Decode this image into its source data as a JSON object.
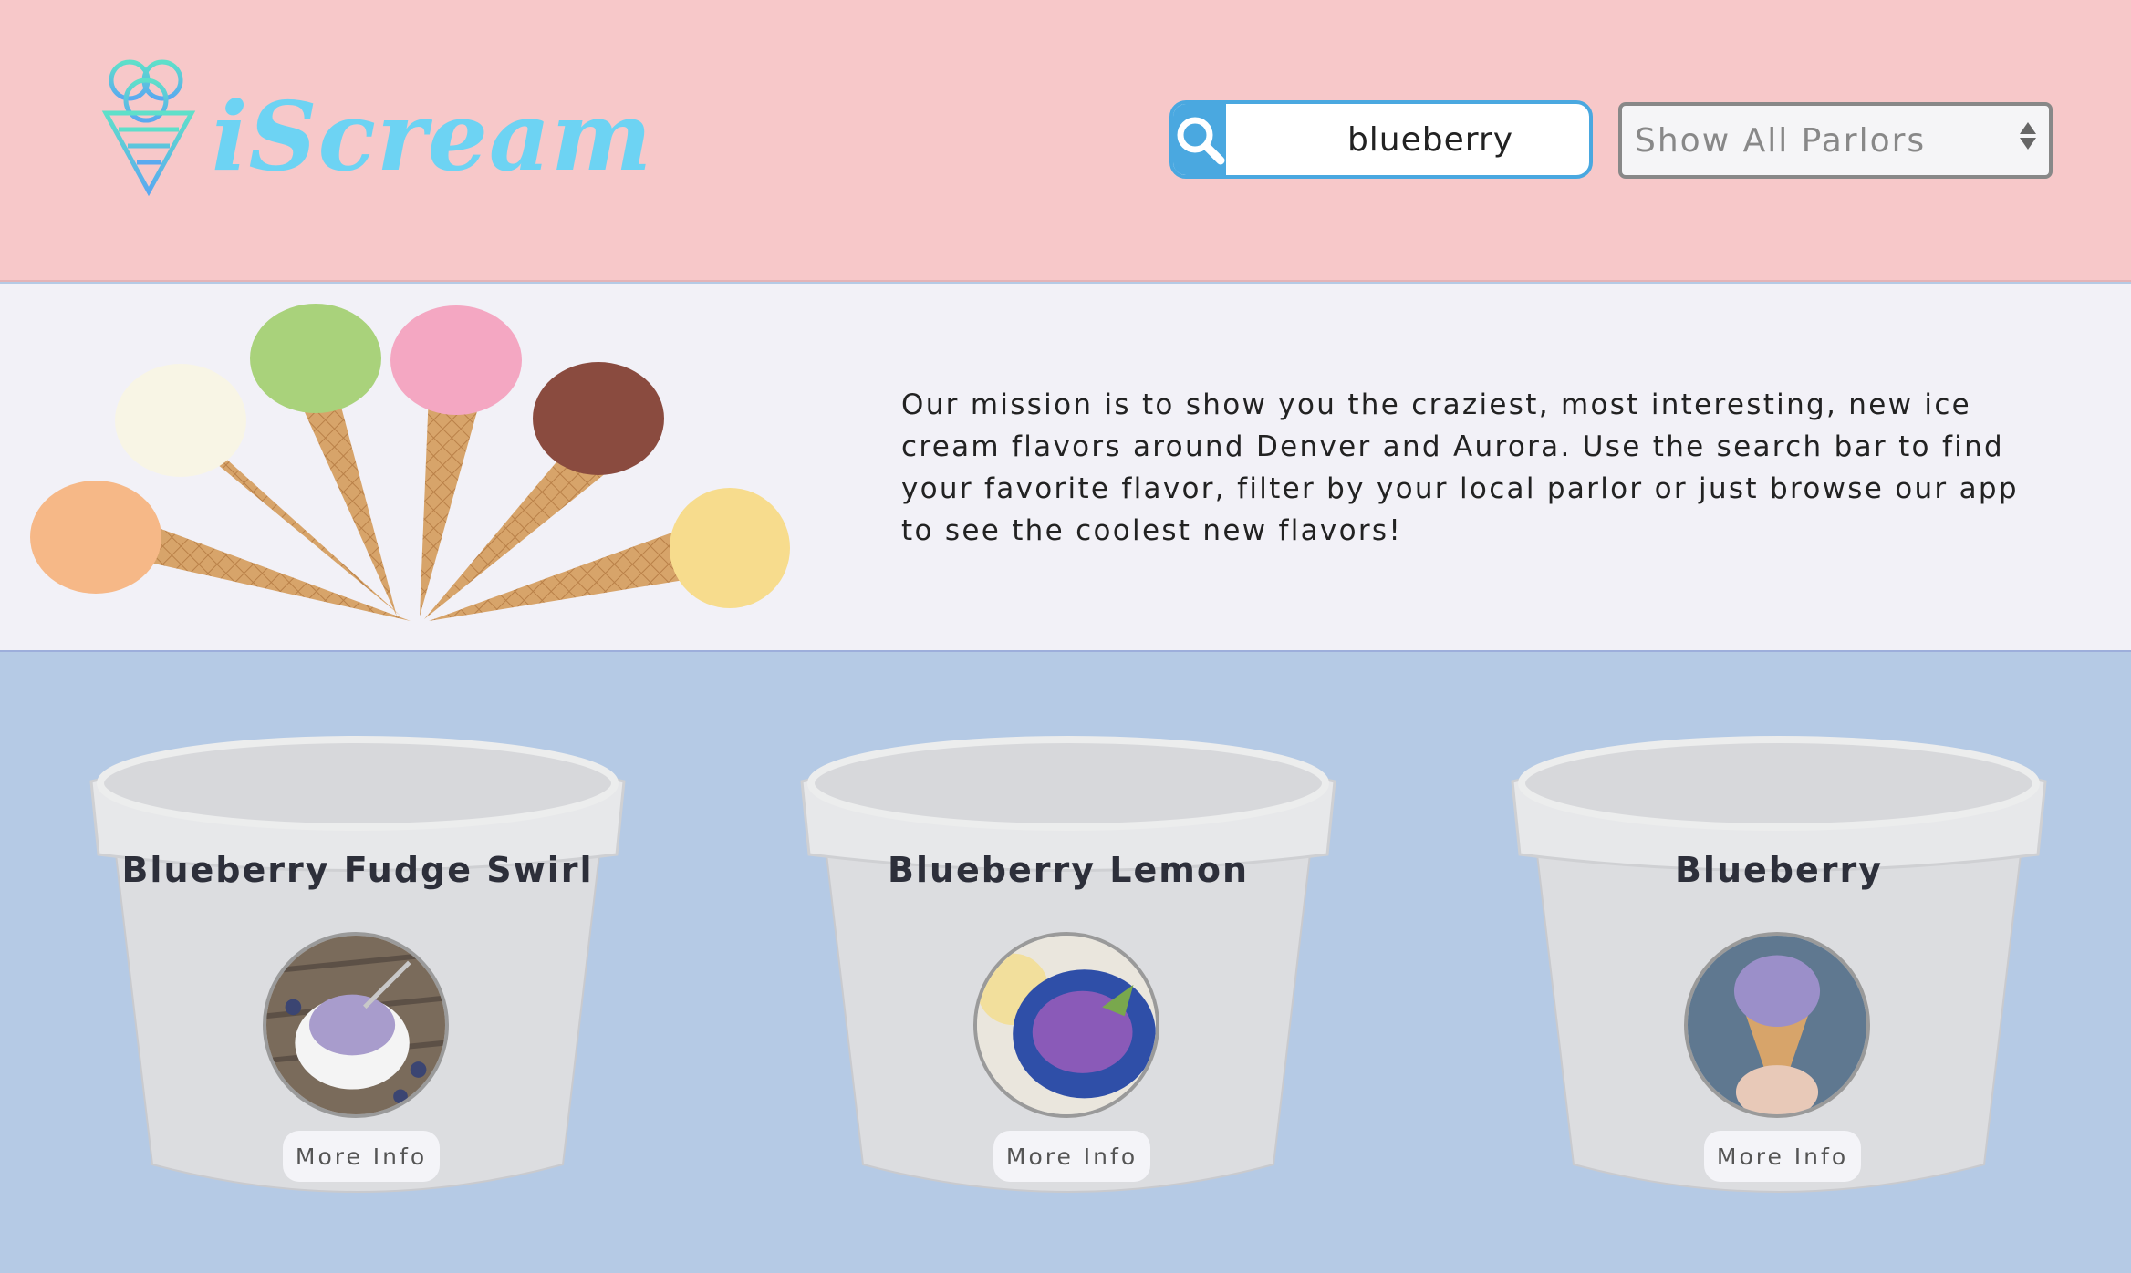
{
  "header": {
    "logo_text": "iScream",
    "search": {
      "value": "blueberry",
      "placeholder": ""
    },
    "parlor_filter": {
      "selected": "Show All Parlors"
    }
  },
  "mission": {
    "text": "Our mission is to show you the craziest, most interesting, new ice cream flavors around Denver and Aurora. Use the search bar to find your favorite flavor, filter by your local parlor or just browse our app to see the coolest new flavors!"
  },
  "cards": [
    {
      "title": "Blueberry Fudge Swirl",
      "button_label": "More Info"
    },
    {
      "title": "Blueberry Lemon",
      "button_label": "More Info"
    },
    {
      "title": "Blueberry",
      "button_label": "More Info"
    }
  ],
  "colors": {
    "header_bg": "#f7c8c9",
    "mission_bg": "#f2f1f7",
    "cards_bg": "#b5cae5",
    "logo": "#6dd3f3",
    "search_accent": "#4aa8e0"
  },
  "icons": {
    "logo": "ice-cream-cone-icon",
    "search": "magnifier-icon",
    "select": "up-down-arrows-icon"
  }
}
